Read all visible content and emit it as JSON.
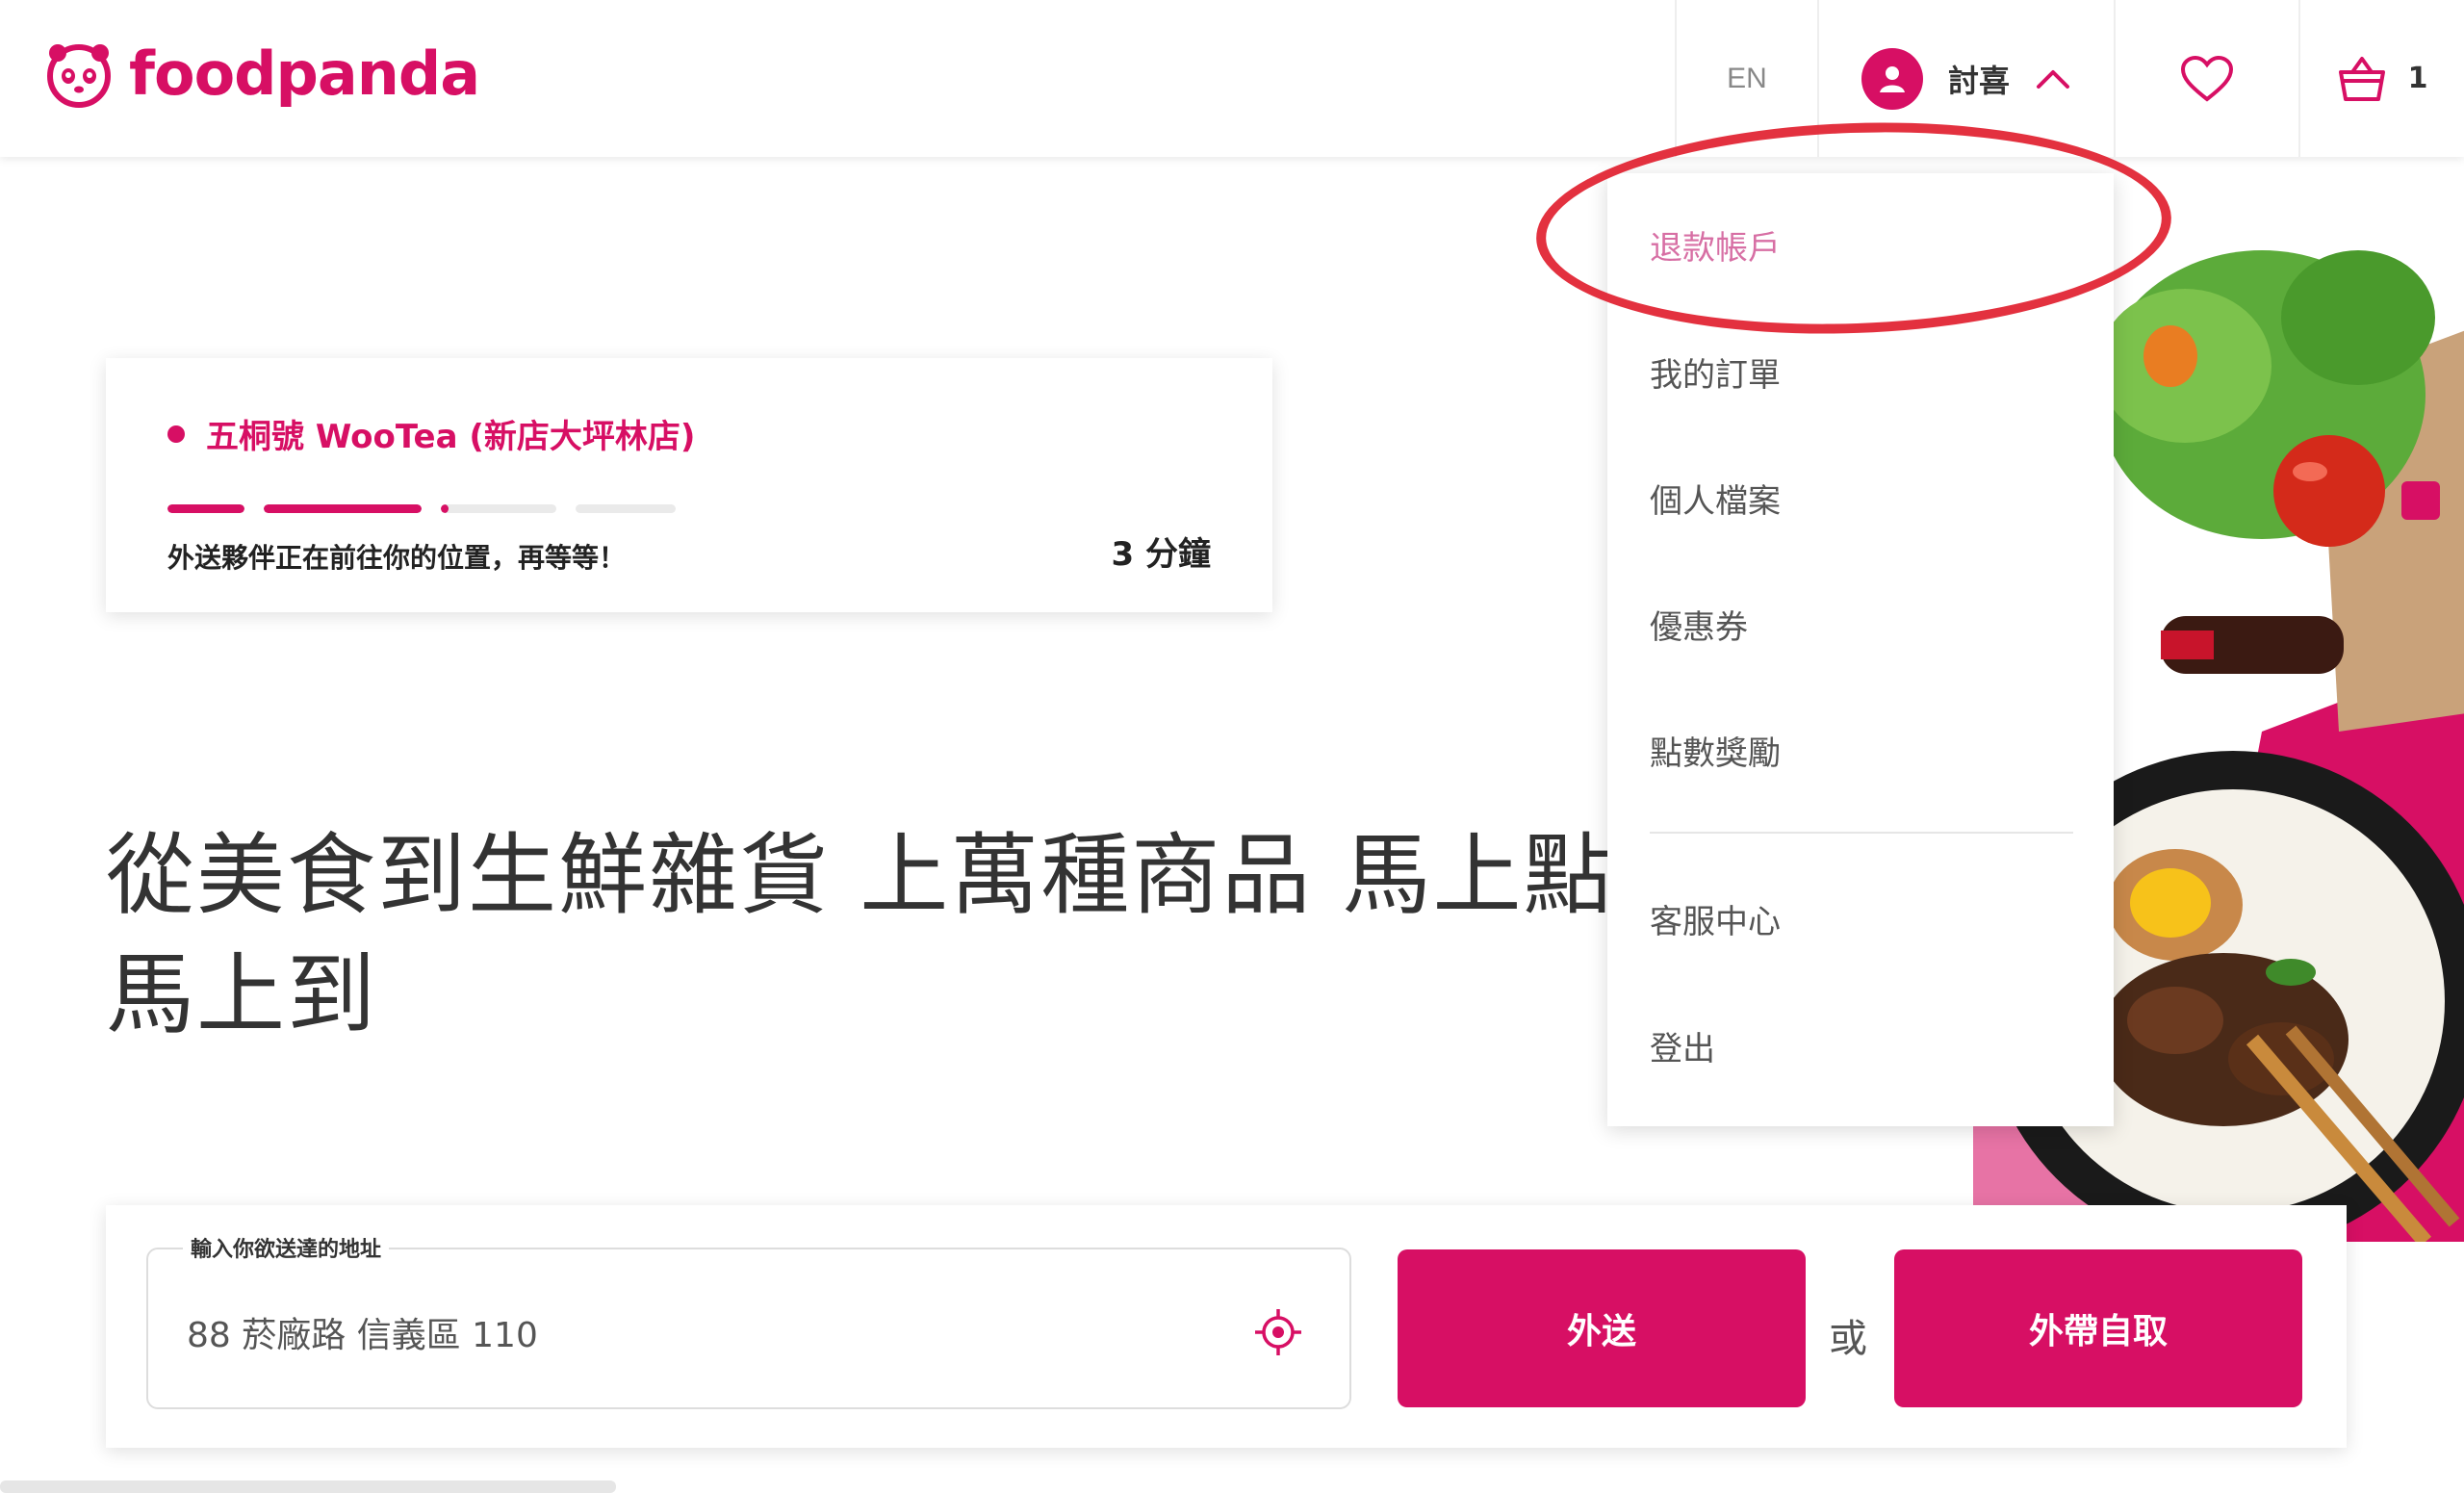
{
  "brand": {
    "name": "foodpanda",
    "color": "#d70f64"
  },
  "header": {
    "language": "EN",
    "user_name": "討喜",
    "cart_count": "1",
    "icons": [
      "panda-logo-icon",
      "user-avatar-icon",
      "chevron-up-icon",
      "heart-icon",
      "basket-icon"
    ]
  },
  "order": {
    "restaurant": "五桐號 WooTea (新店大坪林店)",
    "message": "外送夥伴正在前往你的位置，再等等！",
    "eta": "3 分鐘",
    "progress": [
      1,
      1,
      0.04,
      0,
      0
    ]
  },
  "headline": "從美食到生鮮雜貨 上萬種商品 馬上點馬上到",
  "dropdown": {
    "items": [
      {
        "label": "退款帳戶",
        "active": true
      },
      {
        "label": "我的訂單"
      },
      {
        "label": "個人檔案"
      },
      {
        "label": "優惠券"
      },
      {
        "label": "點數獎勵"
      },
      {
        "label": "客服中心"
      },
      {
        "label": "登出"
      }
    ]
  },
  "search": {
    "label": "輸入你欲送達的地址",
    "value": "88 菸廠路 信義區 110",
    "delivery_button": "外送",
    "or_text": "或",
    "pickup_button": "外帶自取"
  }
}
